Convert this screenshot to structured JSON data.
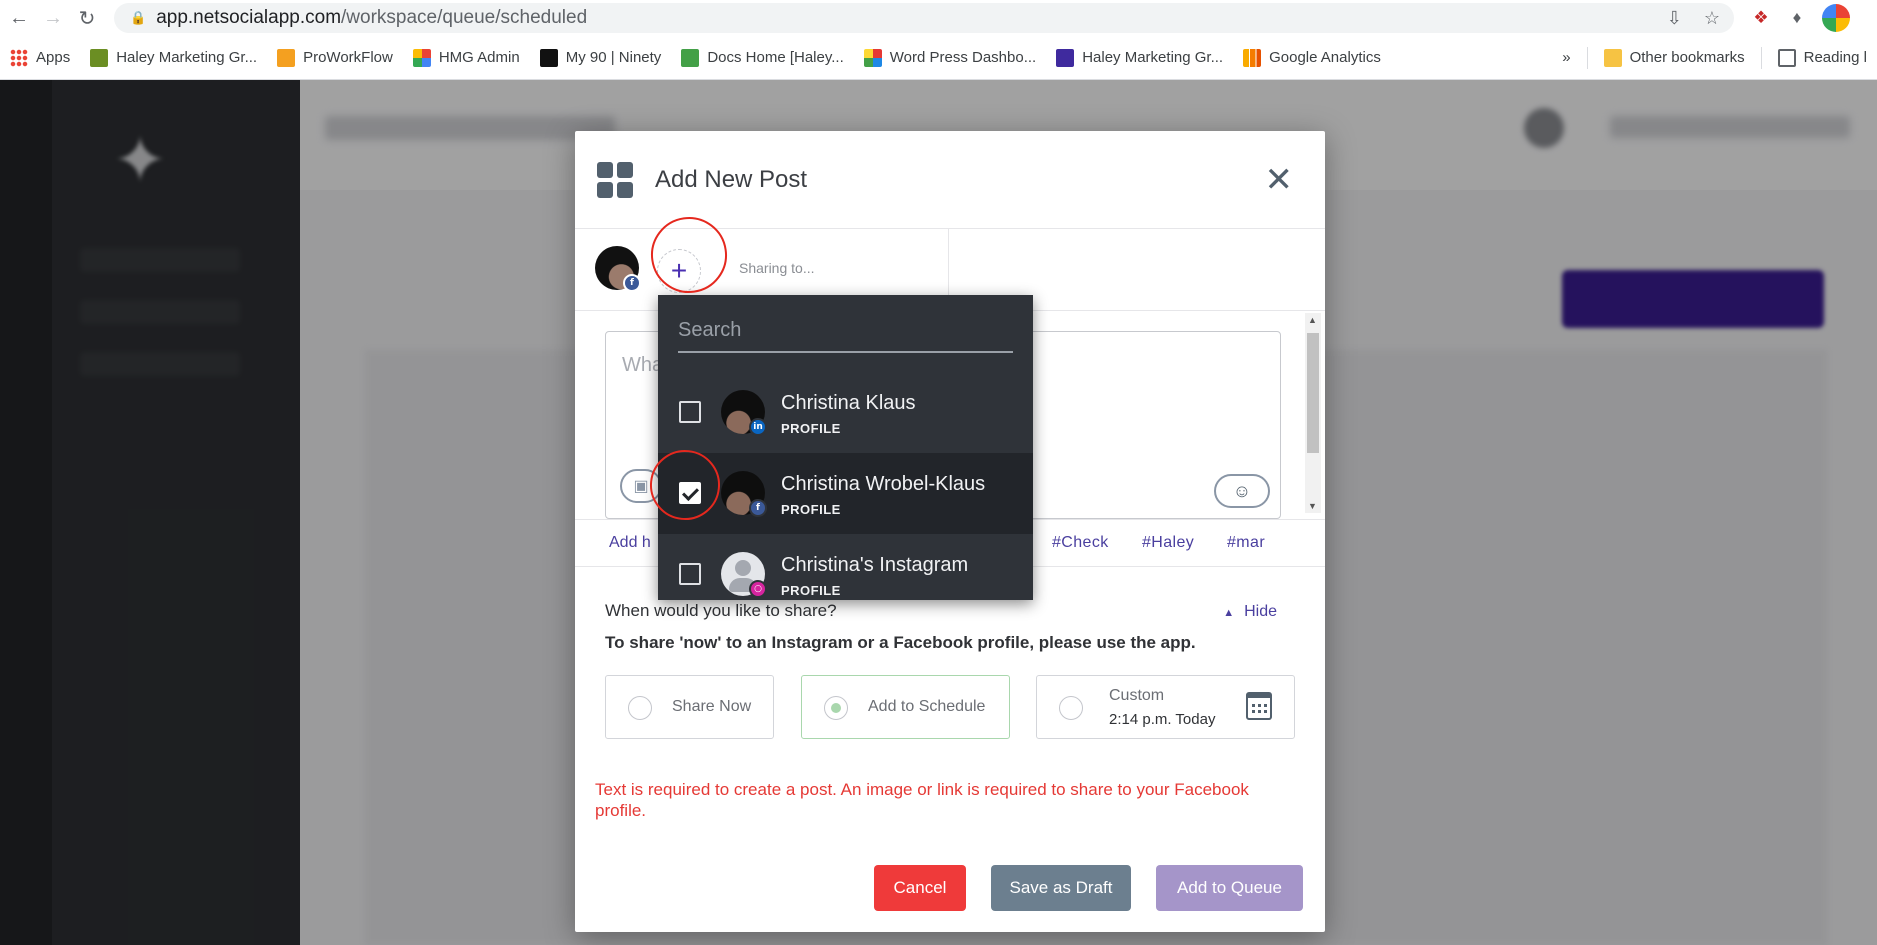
{
  "browser": {
    "url_host": "app.netsocialapp.com",
    "url_path": "/workspace/queue/scheduled",
    "bookmarks": [
      {
        "label": "Apps",
        "color": "#ea4335"
      },
      {
        "label": "Haley Marketing Gr...",
        "color": "#6b8e23"
      },
      {
        "label": "ProWorkFlow",
        "color": "#f4a020"
      },
      {
        "label": "HMG Admin",
        "color": "#ea4335"
      },
      {
        "label": "My 90 | Ninety",
        "color": "#111111"
      },
      {
        "label": "Docs Home [Haley...",
        "color": "#43a047"
      },
      {
        "label": "Word Press Dashbo...",
        "color": "#e53935"
      },
      {
        "label": "Haley Marketing Gr...",
        "color": "#3f2a9e"
      },
      {
        "label": "Google Analytics",
        "color": "#f9ab00"
      }
    ],
    "more_label": "»",
    "other_bookmarks": "Other bookmarks",
    "reading_list": "Reading l"
  },
  "modal": {
    "title": "Add New Post",
    "sharing_to": "Sharing to...",
    "compose_placeholder": "Wha",
    "add_hashtags": "Add h",
    "hashtags": [
      "#Check",
      "#Haley",
      "#mar"
    ],
    "when_title": "When would you like to share?",
    "hide_label": "Hide",
    "share_note": "To share 'now' to an Instagram or a Facebook profile, please use the app.",
    "options": {
      "share_now": "Share Now",
      "add_to_schedule": "Add to Schedule",
      "custom": "Custom",
      "custom_time": "2:14 p.m. Today"
    },
    "error": "Text is required to create a post. An image or link is required to share to your Facebook profile.",
    "buttons": {
      "cancel": "Cancel",
      "save_draft": "Save as Draft",
      "add_queue": "Add to Queue"
    }
  },
  "dropdown": {
    "search_placeholder": "Search",
    "items": [
      {
        "name": "Christina Klaus",
        "type": "PROFILE",
        "network": "linkedin",
        "checked": false
      },
      {
        "name": "Christina Wrobel-Klaus",
        "type": "PROFILE",
        "network": "facebook",
        "checked": true
      },
      {
        "name": "Christina's Instagram",
        "type": "PROFILE",
        "network": "instagram",
        "checked": false
      }
    ]
  },
  "colors": {
    "accent": "#4a2fb2",
    "cancel": "#ef3a3a",
    "draft": "#6c7f8f",
    "queue": "#a595c9",
    "error": "#e53935",
    "annotation": "#e5281e"
  }
}
